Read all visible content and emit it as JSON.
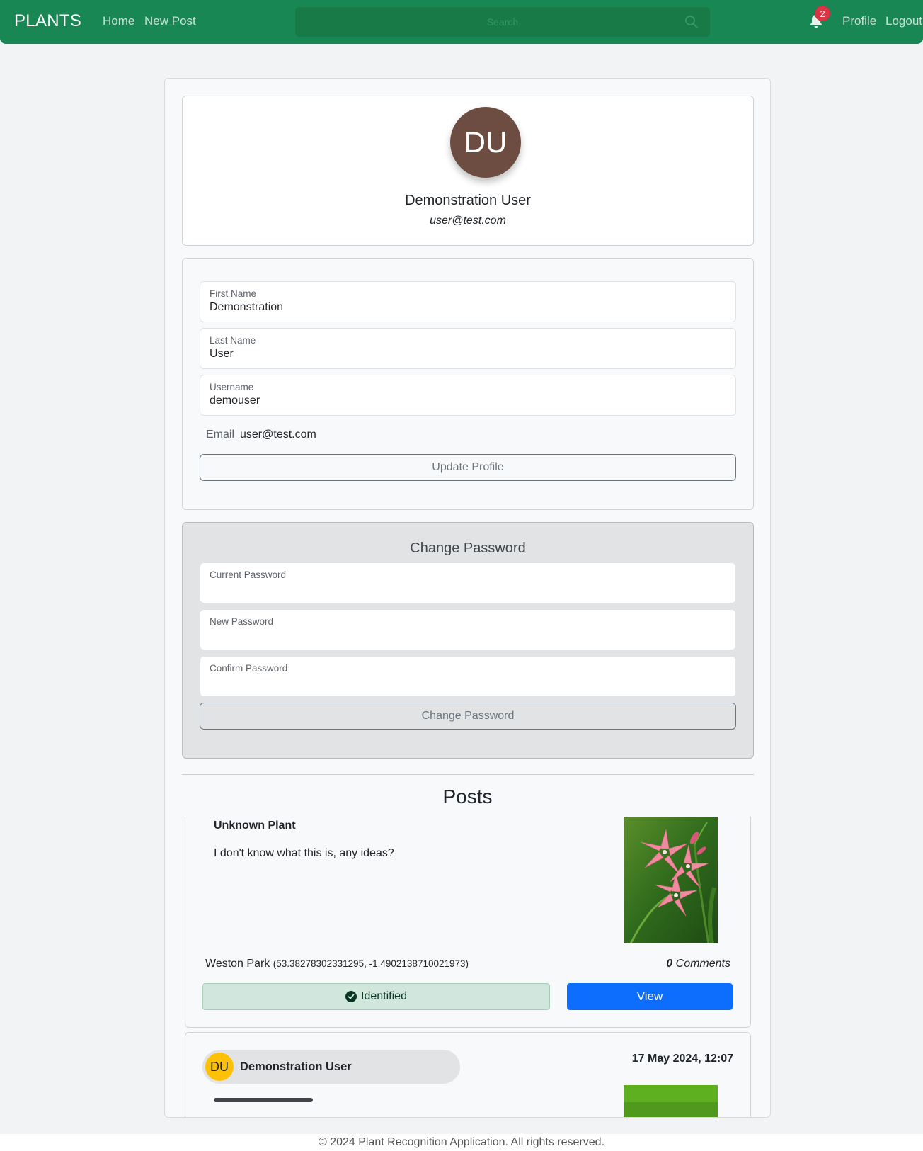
{
  "navbar": {
    "brand": "PLANTS",
    "links": [
      "Home",
      "New Post"
    ],
    "search_placeholder": "Search",
    "notification_count": "2",
    "right_links": [
      "Profile",
      "Logout"
    ]
  },
  "profile_card": {
    "initials": "DU",
    "name": "Demonstration User",
    "email": "user@test.com",
    "avatar_color": "#6d4c41"
  },
  "profile_form": {
    "first_name_label": "First Name",
    "first_name_value": "Demonstration",
    "last_name_label": "Last Name",
    "last_name_value": "User",
    "username_label": "Username",
    "username_value": "demouser",
    "email_label": "Email",
    "email_value": "user@test.com",
    "update_button": "Update Profile"
  },
  "password_form": {
    "title": "Change Password",
    "current_label": "Current Password",
    "new_label": "New Password",
    "confirm_label": "Confirm Password",
    "button": "Change Password"
  },
  "posts": {
    "title": "Posts",
    "items": [
      {
        "title": "Unknown Plant",
        "description": "I don't know what this is, any ideas?",
        "location": "Weston Park",
        "coords": "(53.38278302331295, -1.4902138710021973)",
        "comment_count": "0",
        "comment_label": "Comments",
        "status": "Identified",
        "view_label": "View"
      },
      {
        "author_initials": "DU",
        "author_name": "Demonstration User",
        "date": "17 May 2024, 12:07"
      }
    ]
  },
  "footer": "© 2024 Plant Recognition Application. All rights reserved.",
  "colors": {
    "navbar": "#198754",
    "primary": "#0d6efd",
    "success_bg": "#d1e7dd",
    "badge": "#dc3545",
    "author_avatar": "#ffc107"
  }
}
